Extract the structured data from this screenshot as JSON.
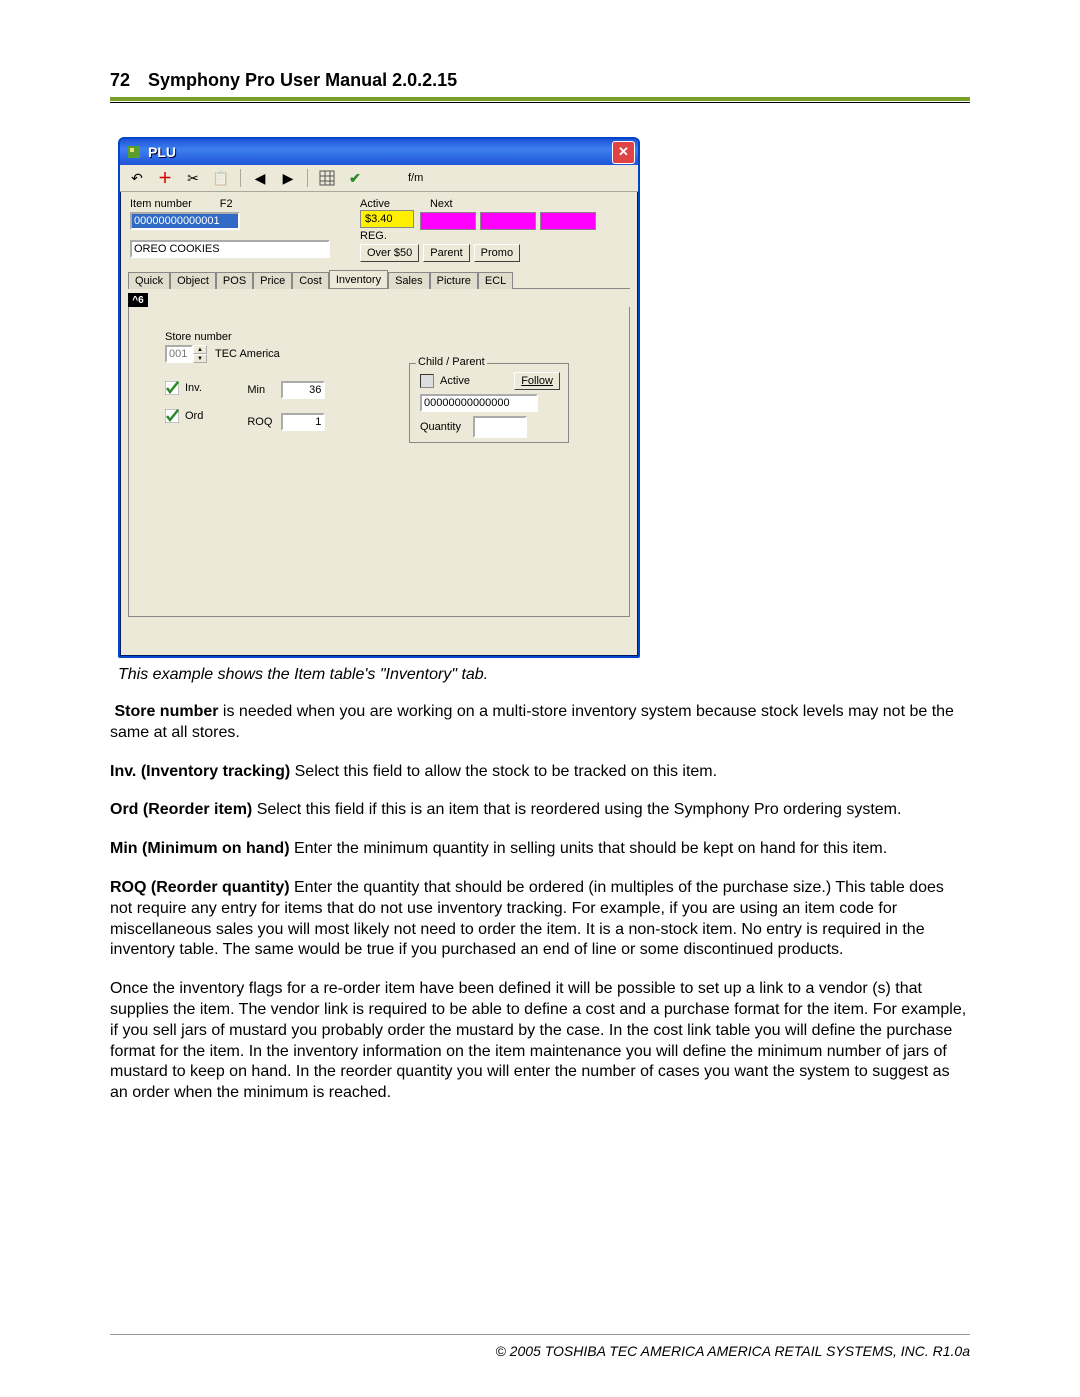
{
  "header": {
    "page_number": "72",
    "manual_title": "Symphony Pro User Manual  2.0.2.15"
  },
  "window": {
    "title": "PLU",
    "toolbar_text": "f/m",
    "item_number_label": "Item number",
    "f2_label": "F2",
    "item_number_value": "00000000000001",
    "description_value": "OREO COOKIES",
    "active_label": "Active",
    "next_label": "Next",
    "price_value": "$3.40",
    "reg_label": "REG.",
    "btn_over50": "Over $50",
    "btn_parent": "Parent",
    "btn_promo": "Promo",
    "tabs": [
      "Quick",
      "Object",
      "POS",
      "Price",
      "Cost",
      "Inventory",
      "Sales",
      "Picture",
      "ECL"
    ],
    "active_tab_index": 5,
    "tabchip": "^6",
    "store_number_label": "Store number",
    "store_number_value": "001",
    "store_name": "TEC America",
    "chk_inv": "Inv.",
    "chk_ord": "Ord",
    "min_label": "Min",
    "min_value": "36",
    "roq_label": "ROQ",
    "roq_value": "1",
    "fieldset_legend": "Child / Parent",
    "fieldset_active": "Active",
    "fieldset_follow": "Follow",
    "fieldset_code": "00000000000000",
    "fieldset_qty_label": "Quantity"
  },
  "caption": "This example shows the Item table's \"Inventory\" tab.",
  "body": {
    "p1_b": "Store number",
    "p1": " is needed when you are working on a multi-store inventory system because stock levels may not be the same at all stores.",
    "p2_b": "Inv. (Inventory tracking)",
    "p2": " Select this field to allow the stock to be tracked on this item.",
    "p3_b": "Ord (Reorder item)",
    "p3": " Select this field if this is an item that is reordered using the Symphony Pro ordering system.",
    "p4_b": "Min (Minimum on hand)",
    "p4": " Enter the minimum quantity in selling units that should be kept on hand for this item.",
    "p5_b": "ROQ (Reorder quantity)",
    "p5": " Enter the quantity that should be ordered (in multiples of the purchase size.)  This table does not require any entry for items that do not use inventory tracking. For example, if you are using an item code for miscellaneous sales you will most likely not need to order the item. It is a non-stock item. No entry is required in the inventory table. The same would be true if you purchased an end of line or some discontinued products.",
    "p6": " Once the inventory flags for a re-order item have been defined it will be possible to set up a link to a vendor (s) that supplies the item. The vendor link is required to be able to define a cost and a purchase format for the item. For example, if you sell jars of mustard you probably order the mustard by the case. In the cost link table you will define the purchase format for the item. In the inventory information on the item maintenance you will define the minimum number of jars of mustard to keep on hand. In the reorder quantity you will enter the number of cases you want the system to suggest as an order when the minimum is reached."
  },
  "footer": "© 2005 TOSHIBA TEC AMERICA AMERICA RETAIL SYSTEMS, INC.   R1.0a"
}
